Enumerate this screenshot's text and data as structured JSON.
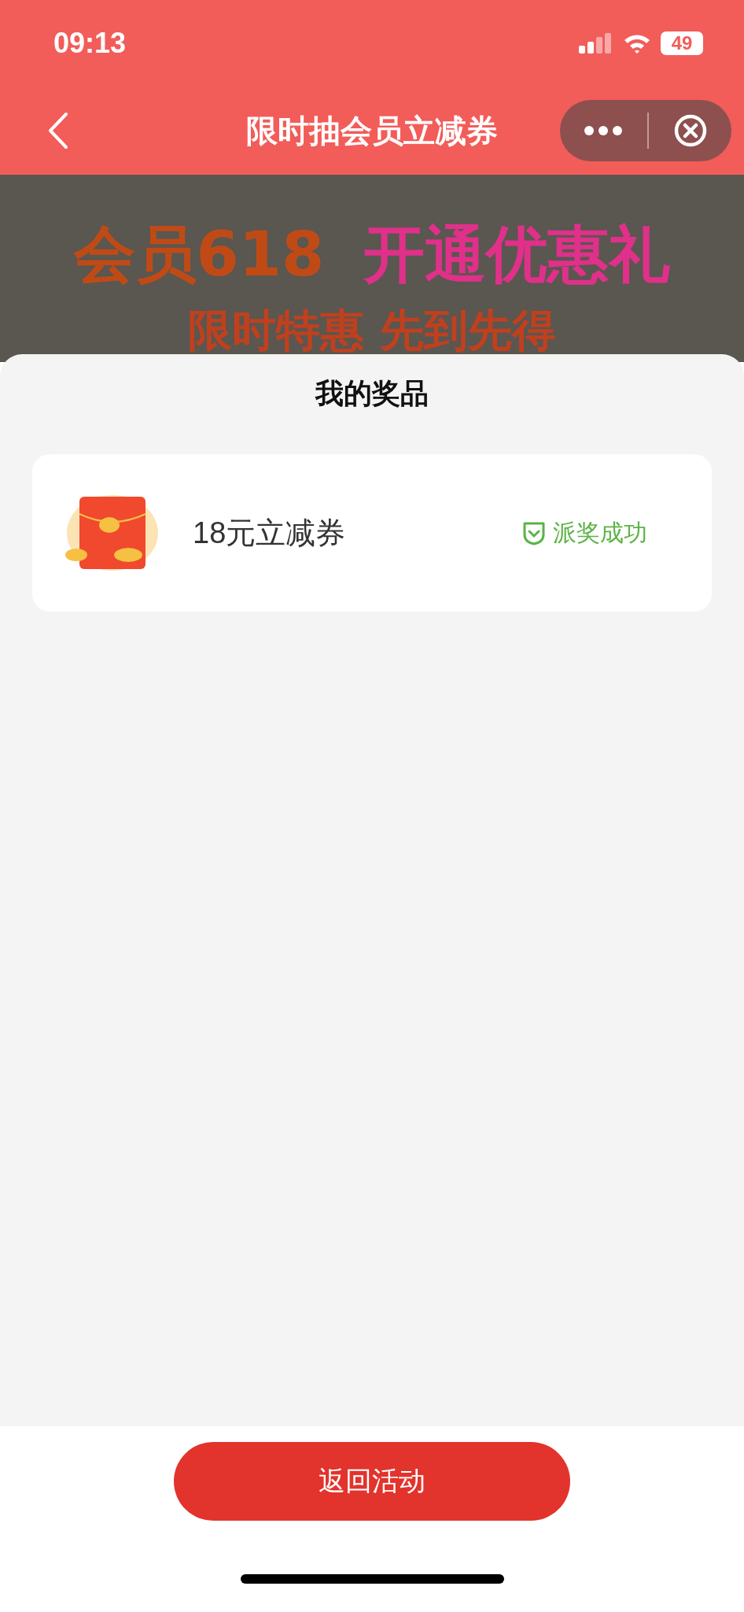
{
  "status_bar": {
    "time": "09:13",
    "battery": "49"
  },
  "nav": {
    "title": "限时抽会员立减券"
  },
  "banner": {
    "headline_left": "会员618",
    "headline_right": "开通优惠礼",
    "subtitle": "限时特惠 先到先得"
  },
  "sheet": {
    "title": "我的奖品",
    "prizes": [
      {
        "name": "18元立减券",
        "status": "派奖成功"
      }
    ]
  },
  "footer": {
    "button": "返回活动"
  }
}
